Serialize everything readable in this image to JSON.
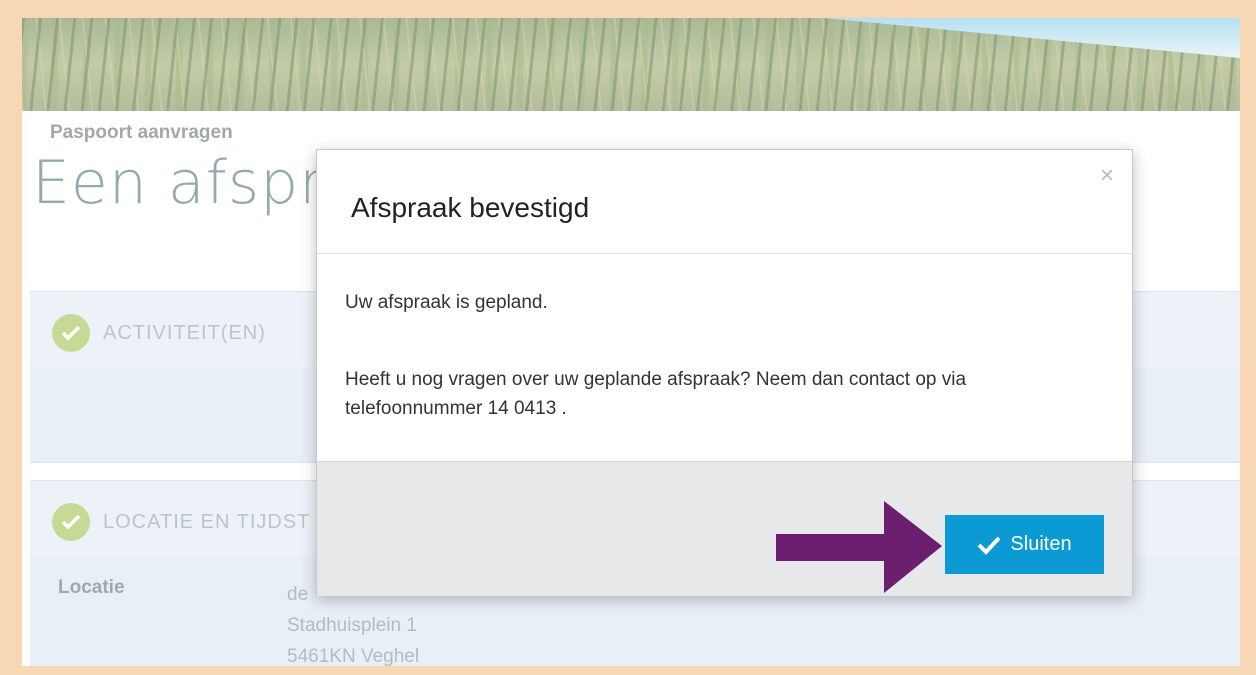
{
  "page": {
    "title": "Een afspr",
    "sections": [
      {
        "heading": "ACTIVITEIT(EN)",
        "items": [
          {
            "label": "Paspoort aanvragen"
          }
        ]
      },
      {
        "heading": "LOCATIE EN TIJDST",
        "location_label": "Locatie",
        "location_lines": [
          "de",
          "Stadhuisplein 1",
          "5461KN Veghel"
        ]
      }
    ]
  },
  "modal": {
    "title": "Afspraak bevestigd",
    "close_symbol": "×",
    "body_line1": "Uw afspraak is gepland.",
    "body_line2": "Heeft u nog vragen over uw geplande afspraak? Neem dan contact op via telefoonnummer 14 0413 .",
    "button_label": "Sluiten",
    "button_icon": "checkmark-icon"
  },
  "colors": {
    "border": "#f4c38c",
    "accent_button": "#0c9ad4",
    "arrow": "#6b1f6e",
    "check_green": "#a8c75e",
    "title_teal": "#5c7d86"
  }
}
